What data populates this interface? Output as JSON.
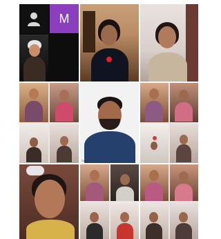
{
  "tiles": {
    "avatar_letter": "M",
    "featured_caption": "Sanjay Kumar"
  },
  "colors": {
    "monogram_bg": "#8b3fbf",
    "mic_badge": "#e0202b"
  },
  "icons": {
    "default_avatar": "person-silhouette-icon",
    "mic": "mic-icon"
  }
}
